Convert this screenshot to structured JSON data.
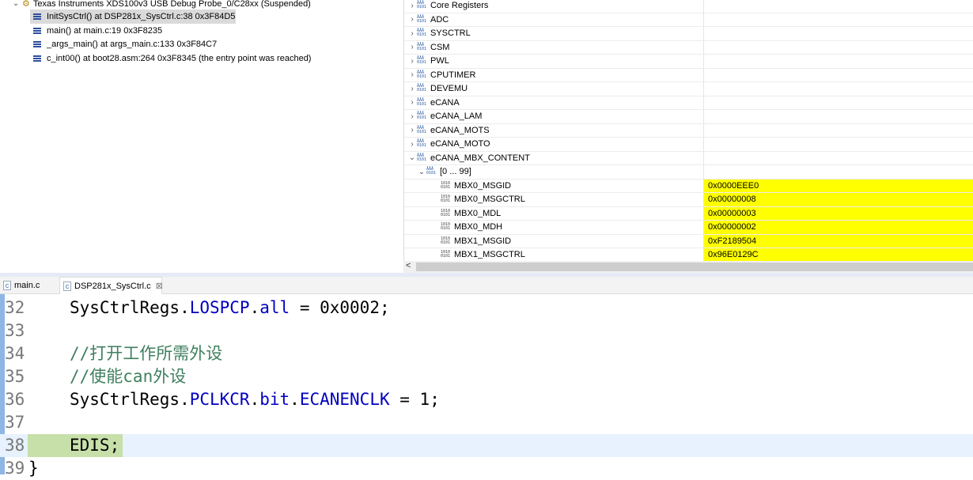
{
  "debug": {
    "target": "Texas Instruments XDS100v3 USB Debug Probe_0/C28xx (Suspended)",
    "frames": [
      "InitSysCtrl() at DSP281x_SysCtrl.c:38 0x3F84D5",
      "main() at main.c:19 0x3F8235",
      "_args_main() at args_main.c:133 0x3F84C7",
      "c_int00() at boot28.asm:264 0x3F8345  (the entry point was reached)"
    ]
  },
  "registers": {
    "groups": [
      "Core Registers",
      "ADC",
      "SYSCTRL",
      "CSM",
      "PWL",
      "CPUTIMER",
      "DEVEMU",
      "eCANA",
      "eCANA_LAM",
      "eCANA_MOTS",
      "eCANA_MOTO",
      "eCANA_MBX_CONTENT"
    ],
    "subgroup": "[0 ... 99]",
    "items": [
      {
        "name": "MBX0_MSGID",
        "value": "0x0000EEE0"
      },
      {
        "name": "MBX0_MSGCTRL",
        "value": "0x00000008"
      },
      {
        "name": "MBX0_MDL",
        "value": "0x00000003"
      },
      {
        "name": "MBX0_MDH",
        "value": "0x00000002"
      },
      {
        "name": "MBX1_MSGID",
        "value": "0xF2189504"
      },
      {
        "name": "MBX1_MSGCTRL",
        "value": "0x96E0129C"
      }
    ],
    "highlight_color": "#ffff00"
  },
  "tabs": [
    {
      "label": "main.c"
    },
    {
      "label": "DSP281x_SysCtrl.c"
    }
  ],
  "editor": {
    "lines": [
      {
        "n": "32",
        "a": "SysCtrlRegs.",
        "b": "LOSPCP",
        "c": ".",
        "d": "all",
        "e": " = 0x0002;"
      },
      {
        "n": "33"
      },
      {
        "n": "34",
        "comment": "//打开工作所需外设"
      },
      {
        "n": "35",
        "comment": "//使能can外设"
      },
      {
        "n": "36",
        "a": "SysCtrlRegs.",
        "b": "PCLKCR",
        "c": ".",
        "d": "bit",
        "e": ".",
        "f": "ECANENCLK",
        "g": " = 1;"
      },
      {
        "n": "37"
      },
      {
        "n": "38",
        "a": "EDIS;"
      },
      {
        "n": "39",
        "a": "}"
      }
    ]
  }
}
